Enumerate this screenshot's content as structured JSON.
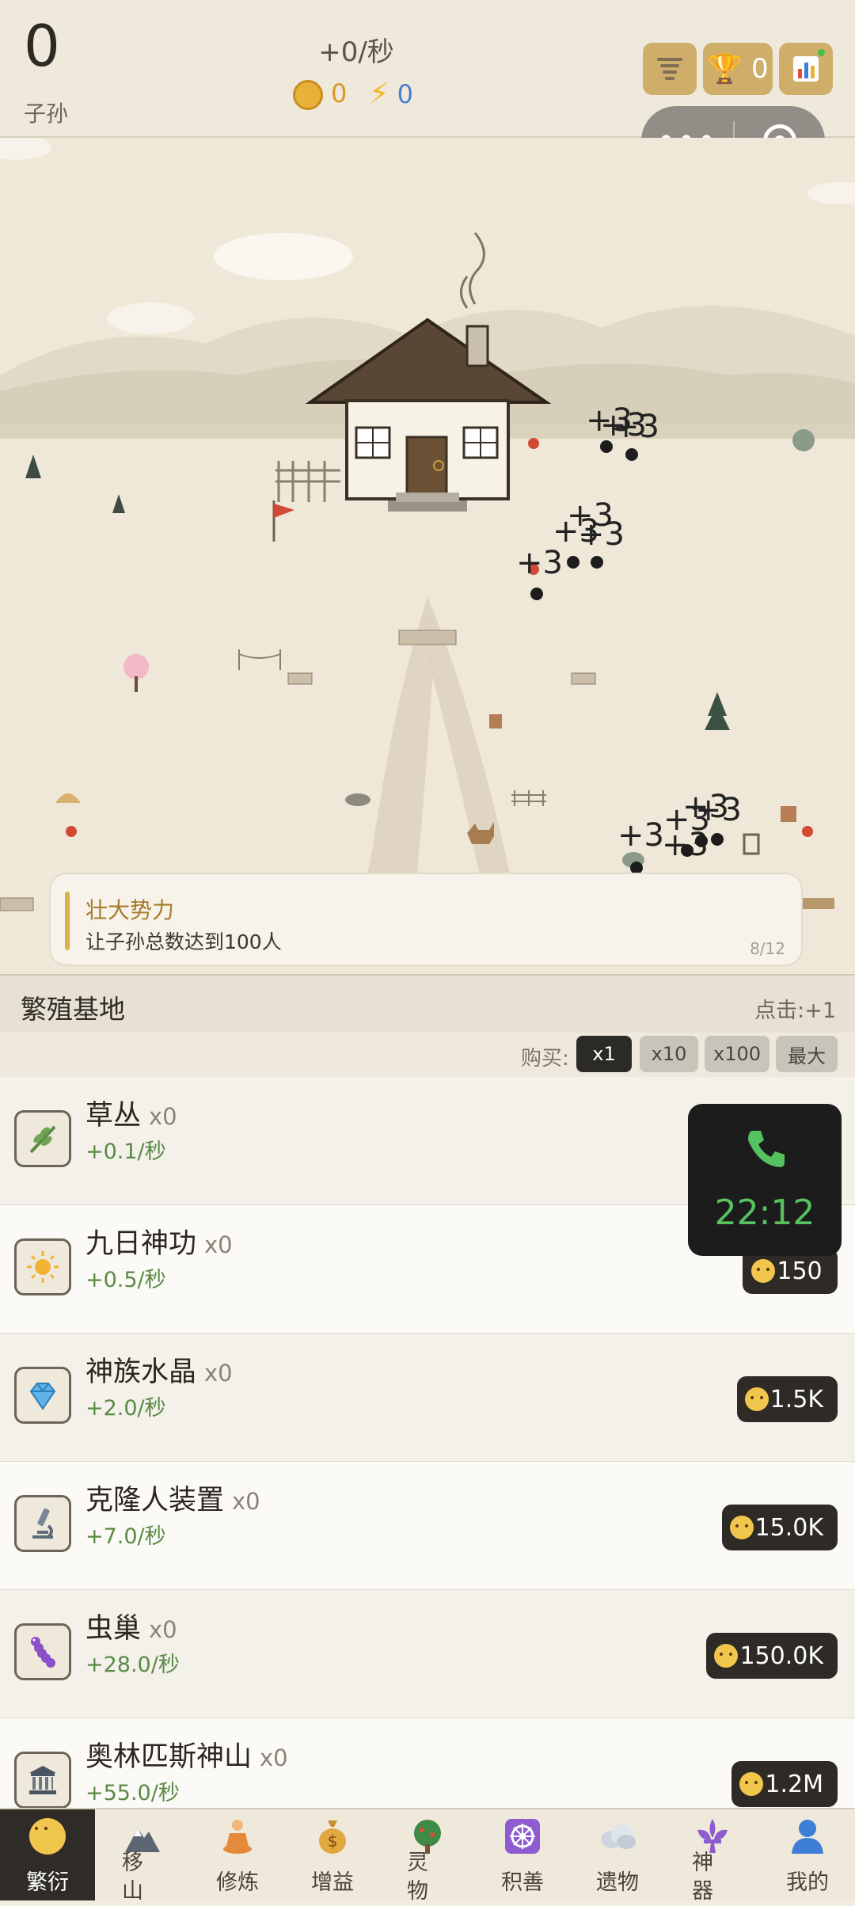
{
  "header": {
    "count": "0",
    "count_label": "子孙",
    "rate": "+0/秒",
    "gold": "0",
    "energy": "0",
    "trophy_count": "0",
    "icons": [
      "tornado-icon",
      "trophy-icon",
      "stats-icon"
    ]
  },
  "capsule": {
    "more": "•••"
  },
  "scene": {
    "floating": [
      "+3",
      "+3",
      "+3",
      "+3",
      "+3",
      "+3",
      "+3",
      "+3",
      "+3",
      "+3",
      "+3",
      "+3"
    ]
  },
  "quest": {
    "title": "壮大势力",
    "desc": "让子孙总数达到100人",
    "progress": "8/12"
  },
  "section": {
    "title": "繁殖基地",
    "click_info": "点击:+1"
  },
  "buy": {
    "label": "购买:",
    "options": [
      "x1",
      "x10",
      "x100",
      "最大"
    ],
    "selected": "x1"
  },
  "items": [
    {
      "name": "草丛",
      "count": "x0",
      "rate": "+0.1/秒",
      "price": "",
      "icon": "sprout-icon"
    },
    {
      "name": "九日神功",
      "count": "x0",
      "rate": "+0.5/秒",
      "price": "150",
      "icon": "sun-icon"
    },
    {
      "name": "神族水晶",
      "count": "x0",
      "rate": "+2.0/秒",
      "price": "1.5K",
      "icon": "crystal-icon"
    },
    {
      "name": "克隆人装置",
      "count": "x0",
      "rate": "+7.0/秒",
      "price": "15.0K",
      "icon": "microscope-icon"
    },
    {
      "name": "虫巢",
      "count": "x0",
      "rate": "+28.0/秒",
      "price": "150.0K",
      "icon": "worm-icon"
    },
    {
      "name": "奥林匹斯神山",
      "count": "x0",
      "rate": "+55.0/秒",
      "price": "1.2M",
      "icon": "temple-icon"
    }
  ],
  "call_overlay": {
    "time": "22:12"
  },
  "nav": [
    {
      "label": "繁衍",
      "icon": "baby-icon",
      "active": true
    },
    {
      "label": "移山",
      "icon": "mountain-icon"
    },
    {
      "label": "修炼",
      "icon": "meditate-icon"
    },
    {
      "label": "增益",
      "icon": "money-bag-icon"
    },
    {
      "label": "灵物",
      "icon": "tree-icon"
    },
    {
      "label": "积善",
      "icon": "dharma-wheel-icon"
    },
    {
      "label": "遗物",
      "icon": "cloud-icon"
    },
    {
      "label": "神器",
      "icon": "fleur-icon"
    },
    {
      "label": "我的",
      "icon": "user-icon"
    }
  ]
}
